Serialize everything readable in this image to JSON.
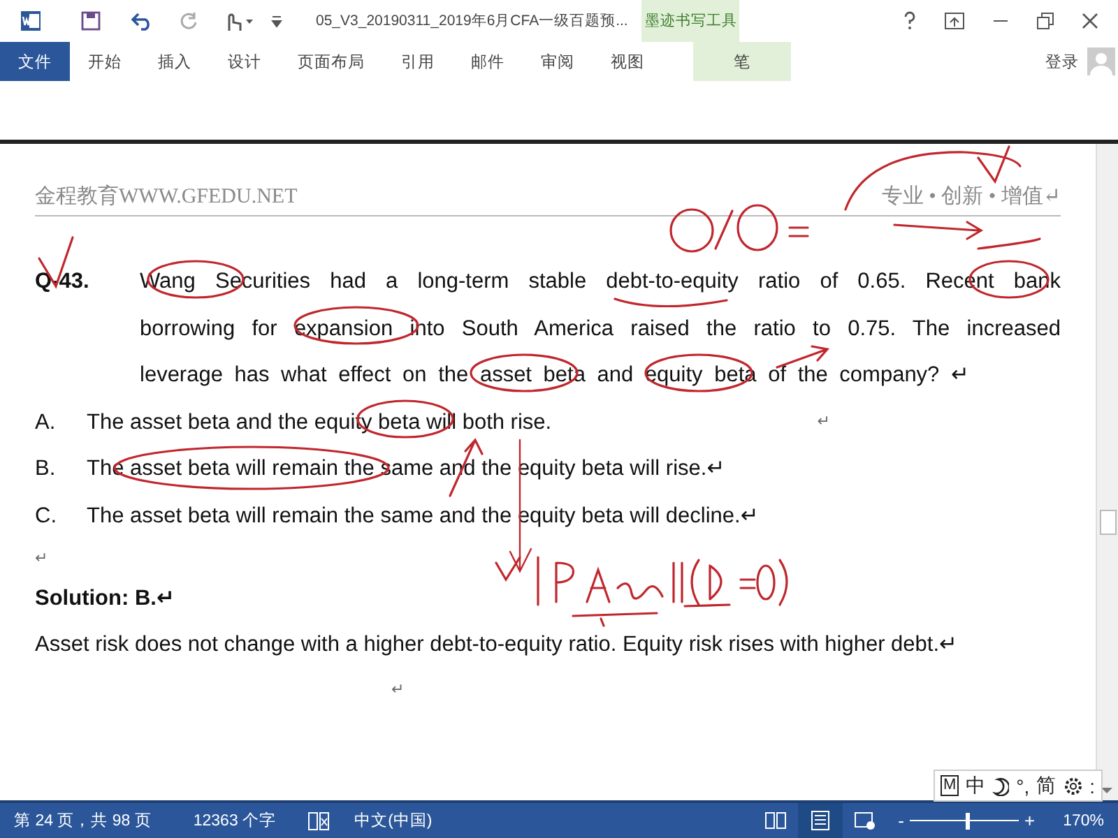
{
  "title_bar": {
    "document_title": "05_V3_20190311_2019年6月CFA一级百题预...",
    "contextual_group": "墨迹书写工具"
  },
  "ribbon": {
    "tabs": [
      {
        "label": "文件",
        "kind": "file",
        "selected": false
      },
      {
        "label": "开始",
        "kind": "normal",
        "selected": false
      },
      {
        "label": "插入",
        "kind": "normal",
        "selected": false
      },
      {
        "label": "设计",
        "kind": "normal",
        "selected": false
      },
      {
        "label": "页面布局",
        "kind": "normal",
        "selected": false
      },
      {
        "label": "引用",
        "kind": "normal",
        "selected": false
      },
      {
        "label": "邮件",
        "kind": "normal",
        "selected": false
      },
      {
        "label": "审阅",
        "kind": "normal",
        "selected": false
      },
      {
        "label": "视图",
        "kind": "normal",
        "selected": false
      },
      {
        "label": "笔",
        "kind": "contextual",
        "selected": false
      }
    ],
    "sign_in": "登录"
  },
  "document": {
    "header_left": "金程教育WWW.GFEDU.NET",
    "header_right": "专业 • 创新 • 增值↵",
    "question": {
      "number": "Q-43.",
      "text": "Wang Securities had a long-term stable debt-to-equity ratio of 0.65. Recent bank borrowing for expansion into South America raised the ratio to 0.75. The increased leverage has what effect on the asset beta and equity beta of the company? ↵"
    },
    "options": [
      {
        "letter": "A.",
        "text": "The asset beta and the equity beta will both rise.",
        "mark": "↵"
      },
      {
        "letter": "B.",
        "text": "The asset beta will remain the same and the equity beta will rise.↵"
      },
      {
        "letter": "C.",
        "text": "The asset beta will remain the same and the equity beta will decline.↵"
      }
    ],
    "empty_paragraph": "↵",
    "solution_title": "Solution: B.↵",
    "solution_text": "Asset risk does not change with a higher debt-to-equity ratio. Equity risk rises with higher debt.↵",
    "trailing_paragraph": "↵"
  },
  "ime_bar": {
    "items": [
      {
        "kind": "boxed",
        "label": "M"
      },
      {
        "kind": "text",
        "label": "中"
      },
      {
        "kind": "moon"
      },
      {
        "kind": "text",
        "label": "°,"
      },
      {
        "kind": "text",
        "label": "简"
      },
      {
        "kind": "gear"
      },
      {
        "kind": "text",
        "label": ":"
      }
    ]
  },
  "status_bar": {
    "page": "第 24 页，共 98 页",
    "word_count": "12363 个字",
    "language": "中文(中国)",
    "views": [
      {
        "kind": "read",
        "selected": false
      },
      {
        "kind": "print",
        "selected": true
      },
      {
        "kind": "web",
        "selected": false
      }
    ],
    "zoom_out": "-",
    "zoom_in": "+",
    "zoom_slider": {
      "level": 0.52
    },
    "zoom": "170%"
  }
}
